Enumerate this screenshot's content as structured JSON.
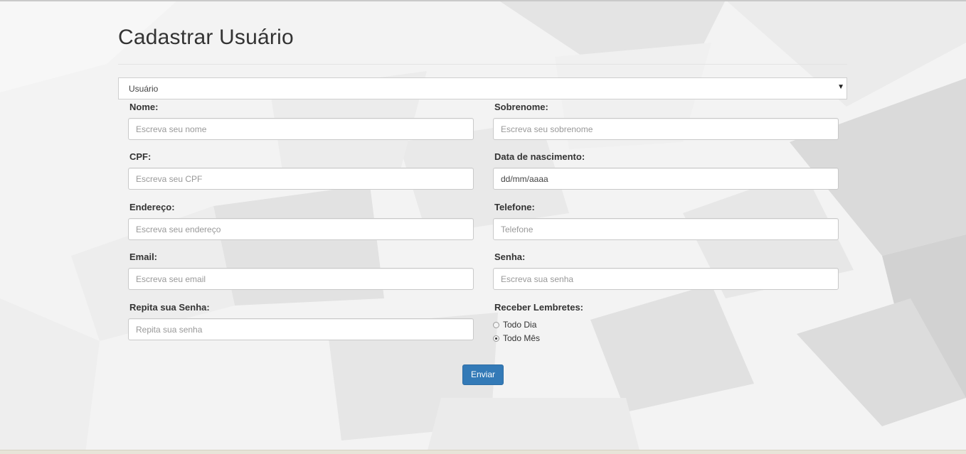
{
  "page": {
    "title": "Cadastrar Usuário"
  },
  "user_type": {
    "selected": "Usuário"
  },
  "form": {
    "nome": {
      "label": "Nome:",
      "placeholder": "Escreva seu nome"
    },
    "sobrenome": {
      "label": "Sobrenome:",
      "placeholder": "Escreva seu sobrenome"
    },
    "cpf": {
      "label": "CPF:",
      "placeholder": "Escreva seu CPF"
    },
    "nascimento": {
      "label": "Data de nascimento:",
      "value": "dd/mm/aaaa"
    },
    "endereco": {
      "label": "Endereço:",
      "placeholder": "Escreva seu endereço"
    },
    "telefone": {
      "label": "Telefone:",
      "placeholder": "Telefone"
    },
    "email": {
      "label": "Email:",
      "placeholder": "Escreva seu email"
    },
    "senha": {
      "label": "Senha:",
      "placeholder": "Escreva sua senha"
    },
    "repita_senha": {
      "label": "Repita sua Senha:",
      "placeholder": "Repita sua senha"
    },
    "lembretes": {
      "label": "Receber Lembretes:",
      "options": [
        {
          "label": "Todo Dia",
          "checked": false
        },
        {
          "label": "Todo Mês",
          "checked": true
        }
      ]
    },
    "submit_label": "Enviar"
  },
  "colors": {
    "primary_button": "#337ab7",
    "background": "#f4f4f4"
  }
}
